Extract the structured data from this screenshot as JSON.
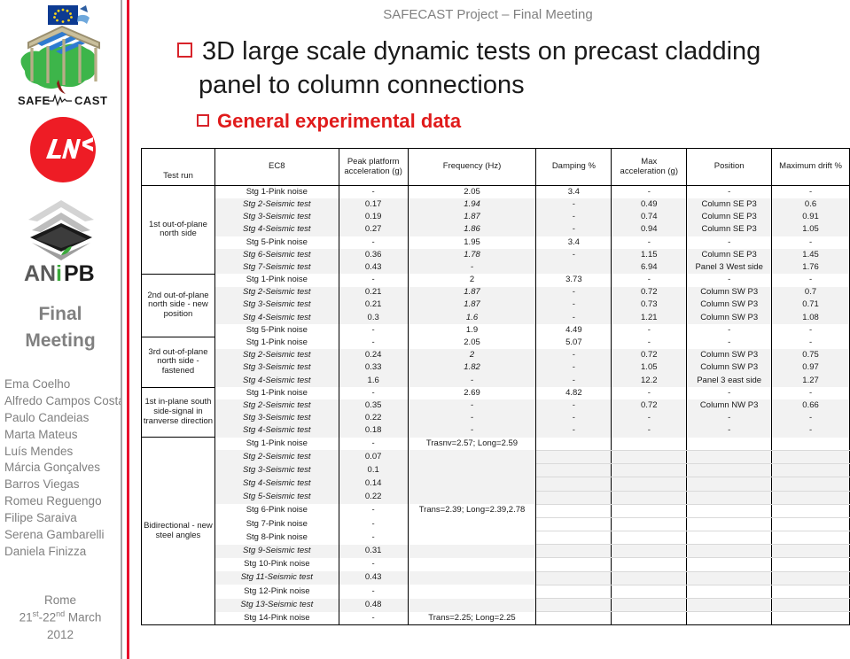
{
  "sidebar": {
    "logos": [
      {
        "name": "safecast-logo",
        "text": "SAFE — CAST"
      },
      {
        "name": "lnec-logo",
        "text": "LNEC"
      },
      {
        "name": "anipb-logo",
        "text": "ANiPB"
      }
    ],
    "heading_line1": "Final",
    "heading_line2": "Meeting",
    "people": [
      "Ema Coelho",
      "Alfredo Campos Costa",
      "Paulo Candeias",
      "Marta Mateus",
      "Luís Mendes",
      "Márcia Gonçalves",
      "Barros Viegas",
      "Romeu Reguengo",
      "Filipe Saraiva",
      "Serena Gambarelli",
      "Daniela Finizza"
    ],
    "city": "Rome",
    "dates_prefix": "21",
    "dates_sup1": "st",
    "dates_mid": "-22",
    "dates_sup2": "nd",
    "dates_suffix": " March",
    "year": "2012",
    "accent_red": "#e8112d",
    "accent_gray": "#a6a6a6"
  },
  "header": {
    "subtitle": "SAFECAST Project – Final Meeting",
    "title_line1": "3D large scale dynamic tests on precast cladding",
    "title_line2": "panel to column connections",
    "section_title": "General experimental data",
    "section_color": "#e01b1b"
  },
  "table": {
    "columns": [
      "Test run",
      "EC8",
      "Peak platform acceleration (g)",
      "Frequency (Hz)",
      "Damping %",
      "Max acceleration (g)",
      "Position",
      "Maximum drift %"
    ],
    "col_peak_l1": "Peak platform",
    "col_peak_l2": "acceleration (g)",
    "col_max_l1": "Max",
    "col_max_l2": "acceleration (g)",
    "groups": [
      {
        "label": "1st out-of-plane north side",
        "rows": [
          {
            "ec8": "Stg 1-Pink noise",
            "type": "pink",
            "peak": "-",
            "freq": "2.05",
            "damp": "3.4",
            "max": "-",
            "pos": "-",
            "drift": "-"
          },
          {
            "ec8": "Stg 2-Seismic test",
            "type": "seismic",
            "peak": "0.17",
            "freq": "1.94",
            "damp": "-",
            "max": "0.49",
            "pos": "Column SE P3",
            "drift": "0.6"
          },
          {
            "ec8": "Stg 3-Seismic test",
            "type": "seismic",
            "peak": "0.19",
            "freq": "1.87",
            "damp": "-",
            "max": "0.74",
            "pos": "Column SE P3",
            "drift": "0.91"
          },
          {
            "ec8": "Stg 4-Seismic test",
            "type": "seismic",
            "peak": "0.27",
            "freq": "1.86",
            "damp": "-",
            "max": "0.94",
            "pos": "Column SE P3",
            "drift": "1.05"
          },
          {
            "ec8": "Stg 5-Pink noise",
            "type": "pink",
            "peak": "-",
            "freq": "1.95",
            "damp": "3.4",
            "max": "-",
            "pos": "-",
            "drift": "-"
          },
          {
            "ec8": "Stg 6-Seismic test",
            "type": "seismic",
            "peak": "0.36",
            "freq": "1.78",
            "damp": "-",
            "max": "1.15",
            "pos": "Column SE P3",
            "drift": "1.45"
          },
          {
            "ec8": "Stg 7-Seismic test",
            "type": "seismic",
            "peak": "0.43",
            "freq": "-",
            "damp": "",
            "max": "6.94",
            "pos": "Panel 3 West side",
            "drift": "1.76"
          }
        ]
      },
      {
        "label": "2nd out-of-plane north side - new position",
        "rows": [
          {
            "ec8": "Stg 1-Pink noise",
            "type": "pink",
            "peak": "-",
            "freq": "2",
            "damp": "3.73",
            "max": "-",
            "pos": "-",
            "drift": "-"
          },
          {
            "ec8": "Stg 2-Seismic test",
            "type": "seismic",
            "peak": "0.21",
            "freq": "1.87",
            "damp": "-",
            "max": "0.72",
            "pos": "Column SW P3",
            "drift": "0.7"
          },
          {
            "ec8": "Stg 3-Seismic test",
            "type": "seismic",
            "peak": "0.21",
            "freq": "1.87",
            "damp": "-",
            "max": "0.73",
            "pos": "Column SW P3",
            "drift": "0.71"
          },
          {
            "ec8": "Stg 4-Seismic test",
            "type": "seismic",
            "peak": "0.3",
            "freq": "1.6",
            "damp": "-",
            "max": "1.21",
            "pos": "Column SW P3",
            "drift": "1.08"
          },
          {
            "ec8": "Stg 5-Pink noise",
            "type": "pink",
            "peak": "-",
            "freq": "1.9",
            "damp": "4.49",
            "max": "-",
            "pos": "-",
            "drift": "-"
          }
        ]
      },
      {
        "label": "3rd out-of-plane north side - fastened",
        "rows": [
          {
            "ec8": "Stg 1-Pink noise",
            "type": "pink",
            "peak": "-",
            "freq": "2.05",
            "damp": "5.07",
            "max": "-",
            "pos": "-",
            "drift": "-"
          },
          {
            "ec8": "Stg 2-Seismic test",
            "type": "seismic",
            "peak": "0.24",
            "freq": "2",
            "damp": "-",
            "max": "0.72",
            "pos": "Column SW P3",
            "drift": "0.75"
          },
          {
            "ec8": "Stg 3-Seismic test",
            "type": "seismic",
            "peak": "0.33",
            "freq": "1.82",
            "damp": "-",
            "max": "1.05",
            "pos": "Column SW P3",
            "drift": "0.97"
          },
          {
            "ec8": "Stg 4-Seismic test",
            "type": "seismic",
            "peak": "1.6",
            "freq": "-",
            "damp": "-",
            "max": "12.2",
            "pos": "Panel 3 east side",
            "drift": "1.27"
          }
        ]
      },
      {
        "label": "1st in-plane south side-signal in tranverse direction",
        "rows": [
          {
            "ec8": "Stg 1-Pink noise",
            "type": "pink",
            "peak": "-",
            "freq": "2.69",
            "damp": "4.82",
            "max": "-",
            "pos": "-",
            "drift": "-"
          },
          {
            "ec8": "Stg 2-Seismic test",
            "type": "seismic",
            "peak": "0.35",
            "freq": "-",
            "damp": "-",
            "max": "0.72",
            "pos": "Column NW P3",
            "drift": "0.66"
          },
          {
            "ec8": "Stg 3-Seismic test",
            "type": "seismic",
            "peak": "0.22",
            "freq": "-",
            "damp": "-",
            "max": "-",
            "pos": "-",
            "drift": "-"
          },
          {
            "ec8": "Stg 4-Seismic test",
            "type": "seismic",
            "peak": "0.18",
            "freq": "-",
            "damp": "-",
            "max": "-",
            "pos": "-",
            "drift": "-"
          }
        ]
      },
      {
        "label": "Bidirectional - new steel angles",
        "rows": [
          {
            "ec8": "Stg 1-Pink noise",
            "type": "pink",
            "peak": "-",
            "freq": "Trasnv=2.57; Long=2.59",
            "damp": "",
            "max": "",
            "pos": "",
            "drift": ""
          },
          {
            "ec8": "Stg 2-Seismic test",
            "type": "seismic",
            "peak": "0.07",
            "freq": "",
            "damp": "",
            "max": "",
            "pos": "",
            "drift": ""
          },
          {
            "ec8": "Stg 3-Seismic test",
            "type": "seismic",
            "peak": "0.1",
            "freq": "",
            "damp": "",
            "max": "",
            "pos": "",
            "drift": ""
          },
          {
            "ec8": "Stg 4-Seismic test",
            "type": "seismic",
            "peak": "0.14",
            "freq": "",
            "damp": "",
            "max": "",
            "pos": "",
            "drift": ""
          },
          {
            "ec8": "Stg 5-Seismic test",
            "type": "seismic",
            "peak": "0.22",
            "freq": "",
            "damp": "",
            "max": "",
            "pos": "",
            "drift": ""
          },
          {
            "ec8": "Stg 6-Pink noise",
            "type": "pink",
            "peak": "-",
            "freq": "Trans=2.39; Long=2.39,2.78",
            "damp": "",
            "max": "",
            "pos": "",
            "drift": ""
          },
          {
            "ec8": "Stg 7-Pink noise",
            "type": "pink",
            "peak": "-",
            "freq": "",
            "damp": "",
            "max": "",
            "pos": "",
            "drift": ""
          },
          {
            "ec8": "Stg 8-Pink noise",
            "type": "pink",
            "peak": "-",
            "freq": "",
            "damp": "",
            "max": "",
            "pos": "",
            "drift": ""
          },
          {
            "ec8": "Stg 9-Seismic test",
            "type": "seismic",
            "peak": "0.31",
            "freq": "",
            "damp": "",
            "max": "",
            "pos": "",
            "drift": ""
          },
          {
            "ec8": "Stg 10-Pink noise",
            "type": "pink",
            "peak": "-",
            "freq": "",
            "damp": "",
            "max": "",
            "pos": "",
            "drift": ""
          },
          {
            "ec8": "Stg 11-Seismic test",
            "type": "seismic",
            "peak": "0.43",
            "freq": "",
            "damp": "",
            "max": "",
            "pos": "",
            "drift": ""
          },
          {
            "ec8": "Stg 12-Pink noise",
            "type": "pink",
            "peak": "-",
            "freq": "",
            "damp": "",
            "max": "",
            "pos": "",
            "drift": ""
          },
          {
            "ec8": "Stg 13-Seismic test",
            "type": "seismic",
            "peak": "0.48",
            "freq": "",
            "damp": "",
            "max": "",
            "pos": "",
            "drift": ""
          },
          {
            "ec8": "Stg 14-Pink noise",
            "type": "pink",
            "peak": "-",
            "freq": "Trans=2.25; Long=2.25",
            "damp": "",
            "max": "",
            "pos": "",
            "drift": ""
          }
        ]
      }
    ]
  }
}
